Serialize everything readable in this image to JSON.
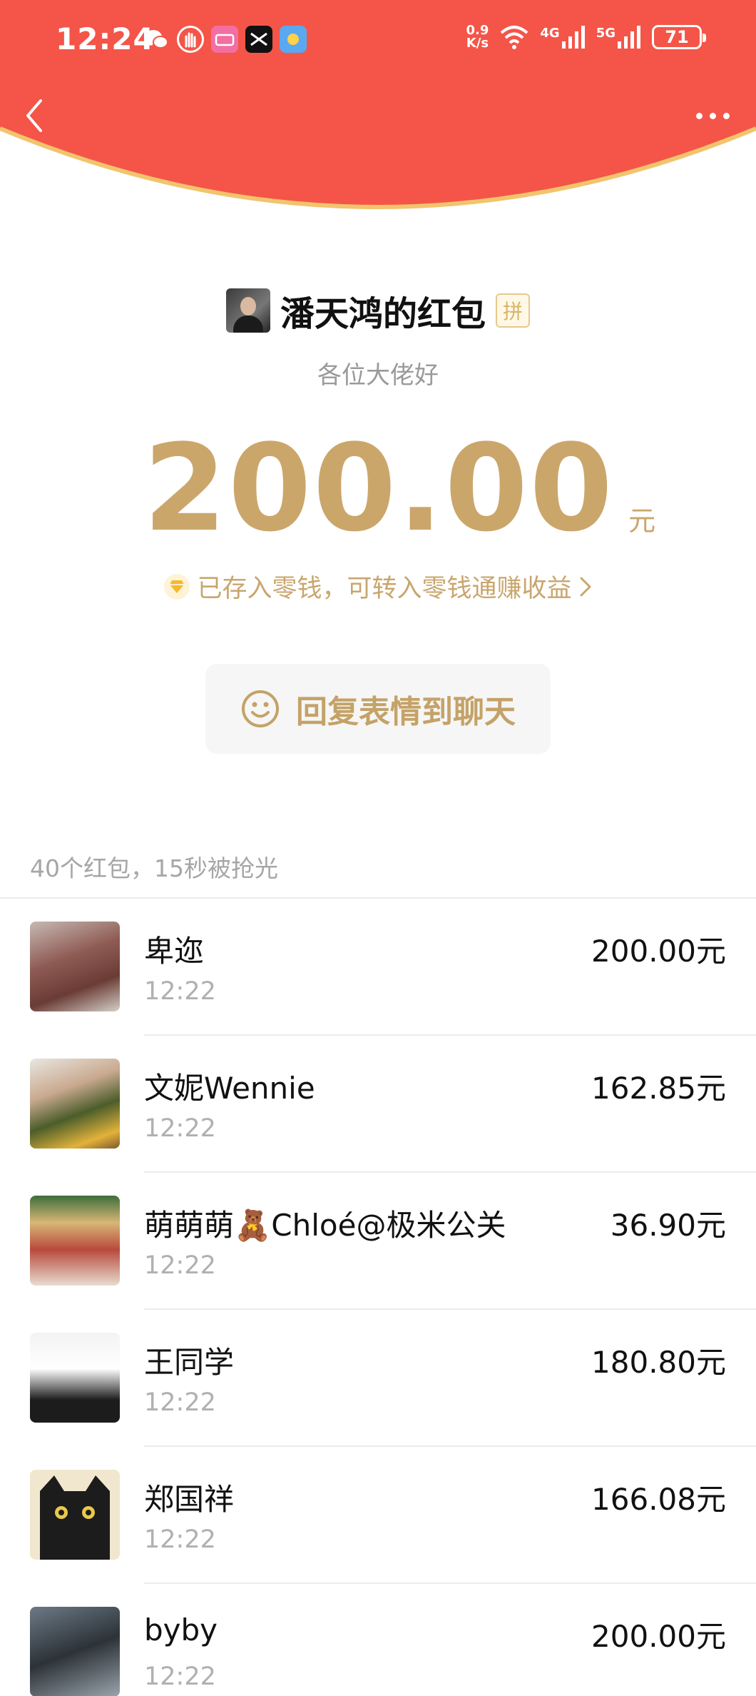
{
  "status_bar": {
    "time": "12:24",
    "net_speed_value": "0.9",
    "net_speed_unit": "K/s",
    "signal_1": "4G",
    "signal_2": "5G",
    "battery": "71"
  },
  "header": {
    "bg_color": "#f45548",
    "edge_color": "#f1c46d"
  },
  "sender": {
    "name": "潘天鸿的红包",
    "badge": "拼",
    "greeting": "各位大佬好"
  },
  "amount": {
    "value": "200.00",
    "unit": "元"
  },
  "saved_note": "已存入零钱，可转入零钱通赚收益",
  "reply_button": "回复表情到聊天",
  "summary": "40个红包，15秒被抢光",
  "recipients": [
    {
      "name": "卑迩",
      "time": "12:22",
      "amount": "200.00元"
    },
    {
      "name": "文妮Wennie",
      "time": "12:22",
      "amount": "162.85元"
    },
    {
      "name": "萌萌萌🧸Chloé@极米公关",
      "time": "12:22",
      "amount": "36.90元"
    },
    {
      "name": "王同学",
      "time": "12:22",
      "amount": "180.80元"
    },
    {
      "name": "郑国祥",
      "time": "12:22",
      "amount": "166.08元"
    },
    {
      "name": "byby",
      "time": "12:22",
      "amount": "200.00元"
    }
  ]
}
